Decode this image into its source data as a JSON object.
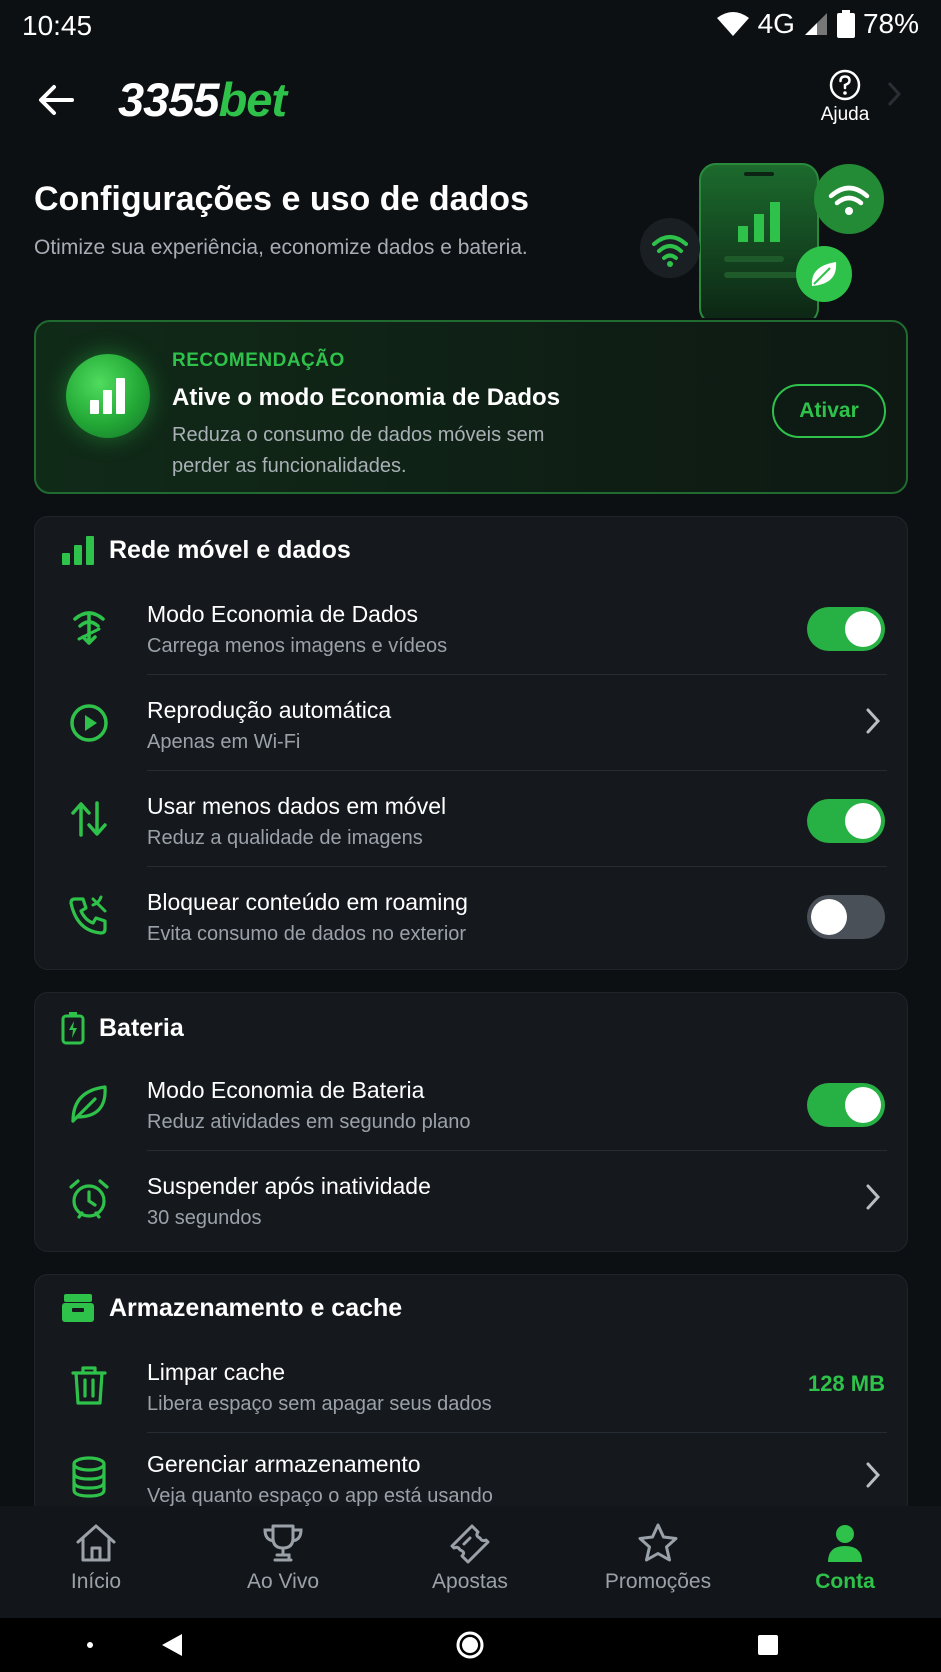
{
  "status_bar": {
    "time": "10:45",
    "network": "4G",
    "battery": "78%"
  },
  "header": {
    "logo_num": "3355",
    "logo_bet": "bet",
    "help_label": "Ajuda"
  },
  "page": {
    "title": "Configurações e uso de dados",
    "subtitle": "Otimize sua experiência, economize dados e bateria."
  },
  "recommendation": {
    "eyebrow": "RECOMENDAÇÃO",
    "title": "Ative o modo Economia de Dados",
    "description": "Reduza o consumo de dados móveis sem perder as funcionalidades.",
    "button": "Ativar"
  },
  "sections": {
    "network": {
      "title": "Rede móvel e dados",
      "rows": [
        {
          "title": "Modo Economia de Dados",
          "subtitle": "Carrega menos imagens e vídeos",
          "control": "toggle",
          "on": true,
          "icon": "data-saver-icon"
        },
        {
          "title": "Reprodução automática",
          "subtitle": "Apenas em Wi-Fi",
          "control": "chevron",
          "icon": "play-circle-icon"
        },
        {
          "title": "Usar menos dados em móvel",
          "subtitle": "Reduz a qualidade de imagens",
          "control": "toggle",
          "on": true,
          "icon": "up-down-arrows-icon"
        },
        {
          "title": "Bloquear conteúdo em roaming",
          "subtitle": "Evita consumo de dados no exterior",
          "control": "toggle",
          "on": false,
          "icon": "phone-roaming-icon"
        }
      ]
    },
    "battery": {
      "title": "Bateria",
      "rows": [
        {
          "title": "Modo Economia de Bateria",
          "subtitle": "Reduz atividades em segundo plano",
          "control": "toggle",
          "on": true,
          "icon": "leaf-icon"
        },
        {
          "title": "Suspender após inatividade",
          "subtitle": "30 segundos",
          "control": "chevron",
          "icon": "alarm-clock-icon"
        }
      ]
    },
    "storage": {
      "title": "Armazenamento e cache",
      "rows": [
        {
          "title": "Limpar cache",
          "subtitle": "Libera espaço sem apagar seus dados",
          "control": "value",
          "value": "128 MB",
          "icon": "trash-icon"
        },
        {
          "title": "Gerenciar armazenamento",
          "subtitle": "Veja quanto espaço o app está usando",
          "control": "chevron",
          "icon": "database-icon"
        }
      ]
    }
  },
  "bottom_nav": {
    "items": [
      {
        "label": "Início",
        "icon": "home-icon",
        "active": false
      },
      {
        "label": "Ao Vivo",
        "icon": "trophy-icon",
        "active": false
      },
      {
        "label": "Apostas",
        "icon": "ticket-icon",
        "active": false
      },
      {
        "label": "Promoções",
        "icon": "star-icon",
        "active": false
      },
      {
        "label": "Conta",
        "icon": "user-icon",
        "active": true
      }
    ]
  },
  "colors": {
    "accent": "#2fc24a",
    "background": "#0d1013",
    "card": "#15191e",
    "muted_text": "#9aa1a8"
  }
}
